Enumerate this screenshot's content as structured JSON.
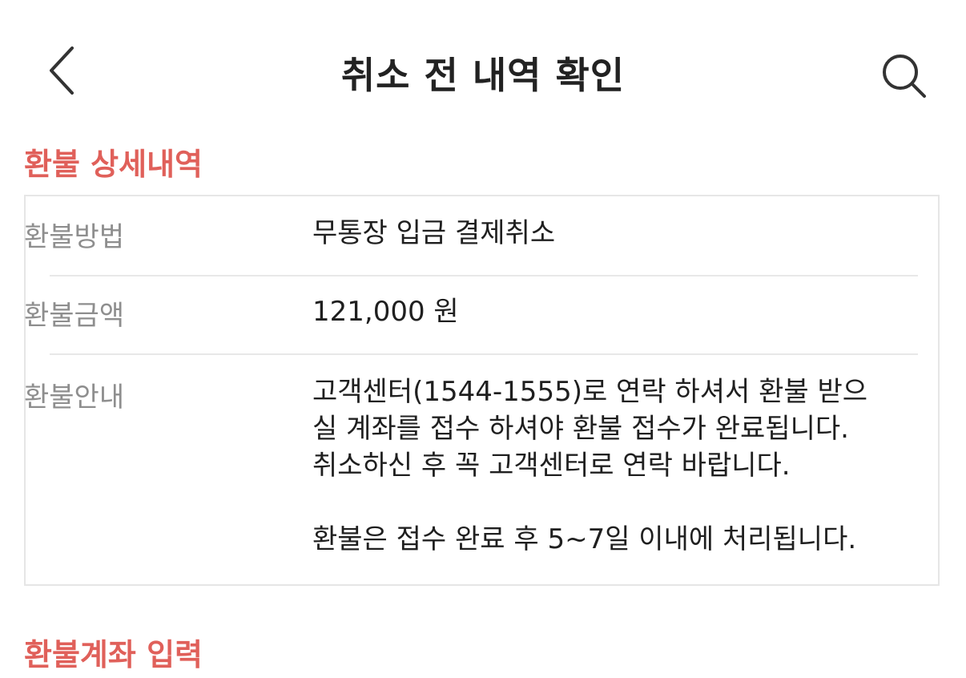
{
  "header": {
    "title": "취소 전 내역 확인"
  },
  "icons": {
    "back": "chevron-left-icon",
    "search": "search-icon"
  },
  "colors": {
    "accent": "#e0605a",
    "label_gray": "#8e8e8e",
    "border": "#e6e6e6"
  },
  "refund_detail": {
    "section_title": "환불 상세내역",
    "rows": [
      {
        "label": "환불방법",
        "value": "무통장 입금 결제취소"
      },
      {
        "label": "환불금액",
        "value": "121,000 원"
      },
      {
        "label": "환불안내",
        "lines": [
          "고객센터(1544-1555)로 연락 하셔서 환불 받으",
          "실 계좌를 접수 하셔야 환불 접수가 완료됩니다.",
          "취소하신 후 꼭 고객센터로 연락 바랍니다.",
          "환불은 접수 완료 후 5~7일 이내에 처리됩니다."
        ]
      }
    ]
  },
  "refund_account": {
    "section_title": "환불계좌 입력"
  }
}
